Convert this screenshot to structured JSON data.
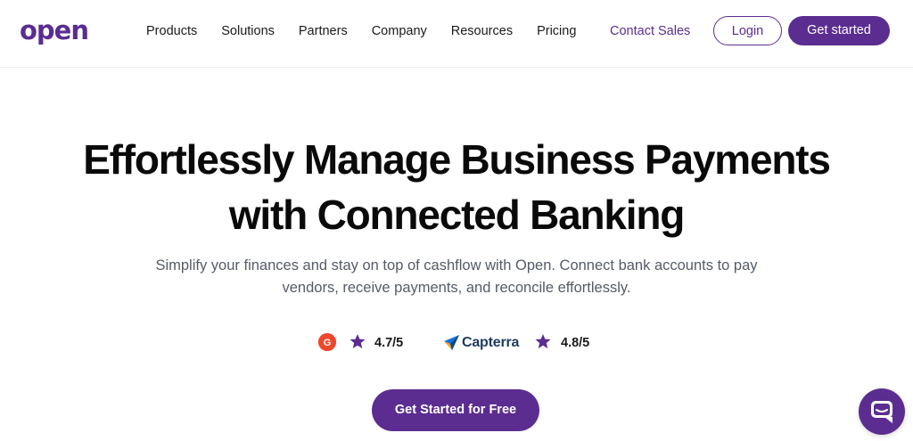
{
  "brand": {
    "logo_text": "open",
    "accent_color": "#5b2d90"
  },
  "nav": {
    "items": [
      {
        "label": "Products"
      },
      {
        "label": "Solutions"
      },
      {
        "label": "Partners"
      },
      {
        "label": "Company"
      },
      {
        "label": "Resources"
      },
      {
        "label": "Pricing"
      }
    ],
    "contact_sales": "Contact Sales",
    "login": "Login",
    "get_started": "Get started"
  },
  "hero": {
    "title_line1": "Effortlessly Manage Business Payments",
    "title_line2": "with Connected Banking",
    "subtitle_line1": "Simplify your finances and stay on top of cashflow with Open. Connect bank accounts to pay",
    "subtitle_line2": "vendors, receive payments, and reconcile effortlessly."
  },
  "ratings": [
    {
      "source_icon": "g2-logo-icon",
      "rating": "4.7/5",
      "icon_color": "#f0462c"
    },
    {
      "source_icon": "capterra-logo-icon",
      "source_label": "Capterra",
      "rating": "4.8/5"
    }
  ],
  "star_color": "#5b2d90",
  "cta": {
    "label": "Get Started for Free"
  },
  "chat_widget": {
    "icon": "chat-bubble-icon"
  }
}
